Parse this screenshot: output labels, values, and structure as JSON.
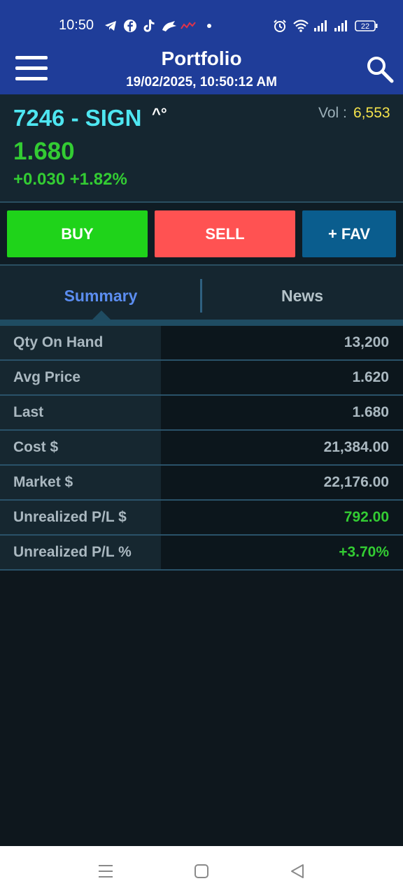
{
  "status_bar": {
    "time": "10:50",
    "notification_icons": [
      "telegram-icon",
      "facebook-icon",
      "tiktok-icon",
      "app-icon",
      "chart-app-icon",
      "dot-icon"
    ],
    "system_icons": [
      "alarm-icon",
      "wifi-icon",
      "signal-icon",
      "signal-icon",
      "battery-icon"
    ],
    "battery": "22"
  },
  "header": {
    "title": "Portfolio",
    "datetime": "19/02/2025, 10:50:12 AM",
    "menu_icon": "hamburger-icon",
    "search_icon": "search-icon"
  },
  "quote": {
    "symbol": "7246 - SIGN",
    "flags": "^°",
    "vol_label": "Vol :",
    "vol_value": "6,553",
    "last_price": "1.680",
    "change": "+0.030 +1.82%"
  },
  "actions": {
    "buy": "BUY",
    "sell": "SELL",
    "fav": "+ FAV"
  },
  "tabs": {
    "summary": "Summary",
    "news": "News",
    "active": "Summary"
  },
  "summary_rows": [
    {
      "label": "Qty On Hand",
      "value": "13,200"
    },
    {
      "label": "Avg Price",
      "value": "1.620"
    },
    {
      "label": "Last",
      "value": "1.680"
    },
    {
      "label": "Cost $",
      "value": "21,384.00"
    },
    {
      "label": "Market $",
      "value": "22,176.00"
    },
    {
      "label": "Unrealized P/L $",
      "value": "792.00"
    },
    {
      "label": "Unrealized P/L %",
      "value": "+3.70%"
    }
  ],
  "colors": {
    "header_bg": "#1f3d99",
    "buy": "#1fd31a",
    "sell": "#ff5252",
    "fav": "#0a5d8e",
    "positive": "#33cc33",
    "symbol": "#4ee6f1",
    "volume": "#f4e34b"
  },
  "nav_bar": [
    "recent-apps-icon",
    "home-icon",
    "back-icon"
  ]
}
